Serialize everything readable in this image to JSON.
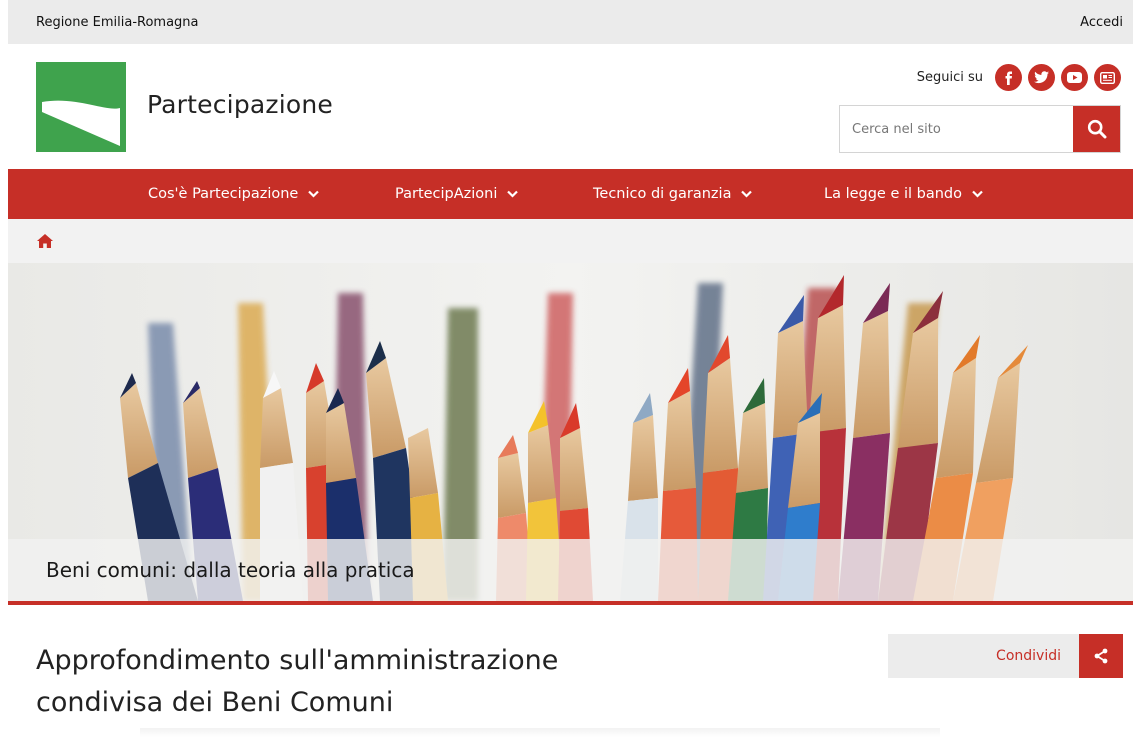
{
  "topbar": {
    "org": "Regione Emilia-Romagna",
    "login": "Accedi"
  },
  "header": {
    "title": "Partecipazione",
    "social_label": "Seguici su",
    "social": [
      "facebook-icon",
      "twitter-icon",
      "youtube-icon",
      "newsletter-icon"
    ],
    "search_placeholder": "Cerca nel sito"
  },
  "nav": {
    "items": [
      {
        "label": "Cos'è Partecipazione"
      },
      {
        "label": "PartecipAzioni"
      },
      {
        "label": "Tecnico di garanzia"
      },
      {
        "label": "La legge e il bando"
      }
    ]
  },
  "hero": {
    "caption": "Beni comuni: dalla teoria alla pratica"
  },
  "main": {
    "title_line1": "Approfondimento sull'amministrazione",
    "title_line2": "condivisa dei Beni Comuni",
    "share_label": "Condividi"
  },
  "colors": {
    "accent": "#c62f27",
    "logo_green": "#3fa34d",
    "topbar_bg": "#ebebeb"
  }
}
